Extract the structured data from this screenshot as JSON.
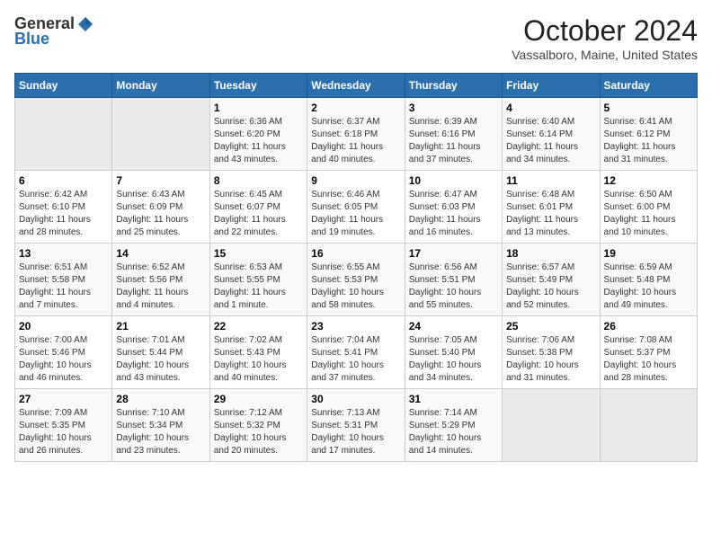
{
  "logo": {
    "general": "General",
    "blue": "Blue"
  },
  "title": "October 2024",
  "subtitle": "Vassalboro, Maine, United States",
  "header_days": [
    "Sunday",
    "Monday",
    "Tuesday",
    "Wednesday",
    "Thursday",
    "Friday",
    "Saturday"
  ],
  "weeks": [
    [
      {
        "day": "",
        "sunrise": "",
        "sunset": "",
        "daylight": ""
      },
      {
        "day": "",
        "sunrise": "",
        "sunset": "",
        "daylight": ""
      },
      {
        "day": "1",
        "sunrise": "Sunrise: 6:36 AM",
        "sunset": "Sunset: 6:20 PM",
        "daylight": "Daylight: 11 hours and 43 minutes."
      },
      {
        "day": "2",
        "sunrise": "Sunrise: 6:37 AM",
        "sunset": "Sunset: 6:18 PM",
        "daylight": "Daylight: 11 hours and 40 minutes."
      },
      {
        "day": "3",
        "sunrise": "Sunrise: 6:39 AM",
        "sunset": "Sunset: 6:16 PM",
        "daylight": "Daylight: 11 hours and 37 minutes."
      },
      {
        "day": "4",
        "sunrise": "Sunrise: 6:40 AM",
        "sunset": "Sunset: 6:14 PM",
        "daylight": "Daylight: 11 hours and 34 minutes."
      },
      {
        "day": "5",
        "sunrise": "Sunrise: 6:41 AM",
        "sunset": "Sunset: 6:12 PM",
        "daylight": "Daylight: 11 hours and 31 minutes."
      }
    ],
    [
      {
        "day": "6",
        "sunrise": "Sunrise: 6:42 AM",
        "sunset": "Sunset: 6:10 PM",
        "daylight": "Daylight: 11 hours and 28 minutes."
      },
      {
        "day": "7",
        "sunrise": "Sunrise: 6:43 AM",
        "sunset": "Sunset: 6:09 PM",
        "daylight": "Daylight: 11 hours and 25 minutes."
      },
      {
        "day": "8",
        "sunrise": "Sunrise: 6:45 AM",
        "sunset": "Sunset: 6:07 PM",
        "daylight": "Daylight: 11 hours and 22 minutes."
      },
      {
        "day": "9",
        "sunrise": "Sunrise: 6:46 AM",
        "sunset": "Sunset: 6:05 PM",
        "daylight": "Daylight: 11 hours and 19 minutes."
      },
      {
        "day": "10",
        "sunrise": "Sunrise: 6:47 AM",
        "sunset": "Sunset: 6:03 PM",
        "daylight": "Daylight: 11 hours and 16 minutes."
      },
      {
        "day": "11",
        "sunrise": "Sunrise: 6:48 AM",
        "sunset": "Sunset: 6:01 PM",
        "daylight": "Daylight: 11 hours and 13 minutes."
      },
      {
        "day": "12",
        "sunrise": "Sunrise: 6:50 AM",
        "sunset": "Sunset: 6:00 PM",
        "daylight": "Daylight: 11 hours and 10 minutes."
      }
    ],
    [
      {
        "day": "13",
        "sunrise": "Sunrise: 6:51 AM",
        "sunset": "Sunset: 5:58 PM",
        "daylight": "Daylight: 11 hours and 7 minutes."
      },
      {
        "day": "14",
        "sunrise": "Sunrise: 6:52 AM",
        "sunset": "Sunset: 5:56 PM",
        "daylight": "Daylight: 11 hours and 4 minutes."
      },
      {
        "day": "15",
        "sunrise": "Sunrise: 6:53 AM",
        "sunset": "Sunset: 5:55 PM",
        "daylight": "Daylight: 11 hours and 1 minute."
      },
      {
        "day": "16",
        "sunrise": "Sunrise: 6:55 AM",
        "sunset": "Sunset: 5:53 PM",
        "daylight": "Daylight: 10 hours and 58 minutes."
      },
      {
        "day": "17",
        "sunrise": "Sunrise: 6:56 AM",
        "sunset": "Sunset: 5:51 PM",
        "daylight": "Daylight: 10 hours and 55 minutes."
      },
      {
        "day": "18",
        "sunrise": "Sunrise: 6:57 AM",
        "sunset": "Sunset: 5:49 PM",
        "daylight": "Daylight: 10 hours and 52 minutes."
      },
      {
        "day": "19",
        "sunrise": "Sunrise: 6:59 AM",
        "sunset": "Sunset: 5:48 PM",
        "daylight": "Daylight: 10 hours and 49 minutes."
      }
    ],
    [
      {
        "day": "20",
        "sunrise": "Sunrise: 7:00 AM",
        "sunset": "Sunset: 5:46 PM",
        "daylight": "Daylight: 10 hours and 46 minutes."
      },
      {
        "day": "21",
        "sunrise": "Sunrise: 7:01 AM",
        "sunset": "Sunset: 5:44 PM",
        "daylight": "Daylight: 10 hours and 43 minutes."
      },
      {
        "day": "22",
        "sunrise": "Sunrise: 7:02 AM",
        "sunset": "Sunset: 5:43 PM",
        "daylight": "Daylight: 10 hours and 40 minutes."
      },
      {
        "day": "23",
        "sunrise": "Sunrise: 7:04 AM",
        "sunset": "Sunset: 5:41 PM",
        "daylight": "Daylight: 10 hours and 37 minutes."
      },
      {
        "day": "24",
        "sunrise": "Sunrise: 7:05 AM",
        "sunset": "Sunset: 5:40 PM",
        "daylight": "Daylight: 10 hours and 34 minutes."
      },
      {
        "day": "25",
        "sunrise": "Sunrise: 7:06 AM",
        "sunset": "Sunset: 5:38 PM",
        "daylight": "Daylight: 10 hours and 31 minutes."
      },
      {
        "day": "26",
        "sunrise": "Sunrise: 7:08 AM",
        "sunset": "Sunset: 5:37 PM",
        "daylight": "Daylight: 10 hours and 28 minutes."
      }
    ],
    [
      {
        "day": "27",
        "sunrise": "Sunrise: 7:09 AM",
        "sunset": "Sunset: 5:35 PM",
        "daylight": "Daylight: 10 hours and 26 minutes."
      },
      {
        "day": "28",
        "sunrise": "Sunrise: 7:10 AM",
        "sunset": "Sunset: 5:34 PM",
        "daylight": "Daylight: 10 hours and 23 minutes."
      },
      {
        "day": "29",
        "sunrise": "Sunrise: 7:12 AM",
        "sunset": "Sunset: 5:32 PM",
        "daylight": "Daylight: 10 hours and 20 minutes."
      },
      {
        "day": "30",
        "sunrise": "Sunrise: 7:13 AM",
        "sunset": "Sunset: 5:31 PM",
        "daylight": "Daylight: 10 hours and 17 minutes."
      },
      {
        "day": "31",
        "sunrise": "Sunrise: 7:14 AM",
        "sunset": "Sunset: 5:29 PM",
        "daylight": "Daylight: 10 hours and 14 minutes."
      },
      {
        "day": "",
        "sunrise": "",
        "sunset": "",
        "daylight": ""
      },
      {
        "day": "",
        "sunrise": "",
        "sunset": "",
        "daylight": ""
      }
    ]
  ]
}
